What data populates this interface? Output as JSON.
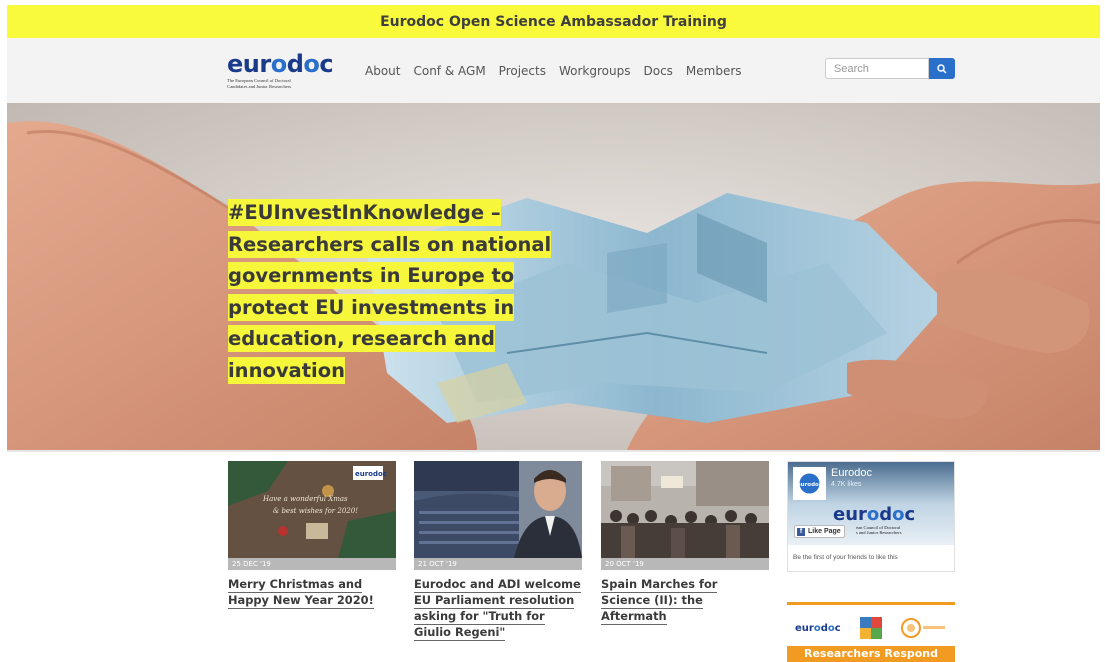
{
  "banner": {
    "text": "Eurodoc Open Science Ambassador Training"
  },
  "logo": {
    "word": "eurodoc",
    "tagline": "The European Council of Doctoral\nCandidates and Junior Researchers"
  },
  "nav": {
    "items": [
      {
        "label": "About"
      },
      {
        "label": "Conf & AGM"
      },
      {
        "label": "Projects"
      },
      {
        "label": "Workgroups"
      },
      {
        "label": "Docs"
      },
      {
        "label": "Members"
      }
    ]
  },
  "search": {
    "placeholder": "Search",
    "icon": "search-icon"
  },
  "hero": {
    "headline": "#EUInvestInKnowledge – Researchers calls on national governments in Europe to protect EU investments in education, research and innovation"
  },
  "posts": [
    {
      "date": "25 DEC '19",
      "title": "Merry Christmas and Happy New Year 2020!"
    },
    {
      "date": "21 OCT '19",
      "title": "Eurodoc and ADI welcome EU Parliament resolution asking for \"Truth for Giulio Regeni\""
    },
    {
      "date": "20 OCT '19",
      "title": "Spain Marches for Science (II): the Aftermath"
    }
  ],
  "facebook": {
    "page_name": "Eurodoc",
    "likes": "4.7K likes",
    "like_button": "Like Page",
    "friends_text": "Be the first of your friends to like this",
    "cover_word": "eurodoc",
    "cover_tagline": "ean Council of Doctoral\ns and Junior Researchers"
  },
  "researchers_respond": {
    "button": "Researchers Respond",
    "logo_word": "eurodoc"
  },
  "colors": {
    "banner": "#fafa3c",
    "highlight": "#f6f63a",
    "brand_blue": "#2a6fc9",
    "brand_navy": "#1a3a8a",
    "orange": "#f29b22"
  }
}
